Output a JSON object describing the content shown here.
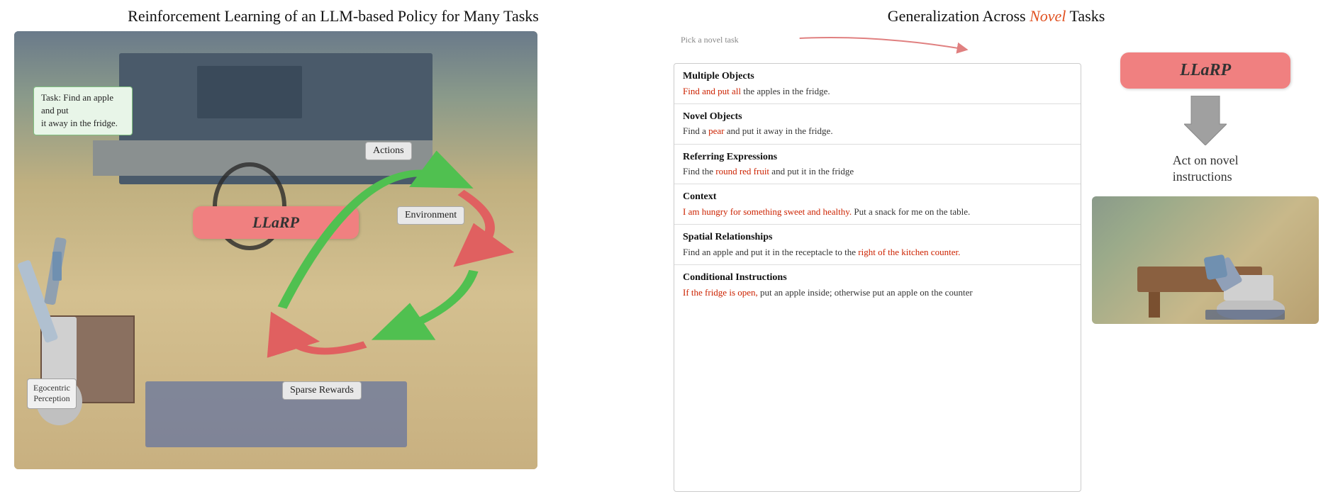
{
  "left": {
    "title": "Reinforcement Learning of an LLM-based Policy for Many Tasks",
    "task_label_line1": "Task: Find an apple and put",
    "task_label_line2": "it away in the fridge.",
    "llaarp_label": "LLaRP",
    "actions_label": "Actions",
    "environment_label": "Environment",
    "sparse_rewards_label": "Sparse Rewards",
    "egocentric_label_line1": "Egocentric",
    "egocentric_label_line2": "Perception"
  },
  "right": {
    "title_prefix": "Generalization Across ",
    "title_novel": "Novel",
    "title_suffix": " Tasks",
    "pick_novel_label": "Pick a novel task",
    "llaarp_label": "LLaRP",
    "act_on_label_line1": "Act on novel",
    "act_on_label_line2": "instructions",
    "tasks": [
      {
        "title": "Multiple Objects",
        "desc_before": "",
        "desc_highlight": "Find and put all",
        "desc_after": " the apples in the fridge."
      },
      {
        "title": "Novel Objects",
        "desc_before": "Find a ",
        "desc_highlight": "pear",
        "desc_after": " and put it away in the fridge."
      },
      {
        "title": "Referring Expressions",
        "desc_before": "Find the ",
        "desc_highlight": "round red fruit",
        "desc_after": " and put it in the fridge"
      },
      {
        "title": "Context",
        "desc_before": "",
        "desc_highlight": "I am hungry for something sweet and healthy.",
        "desc_after": " Put a snack for me on the table."
      },
      {
        "title": "Spatial Relationships",
        "desc_before": "Find an apple and put it in the receptacle to the ",
        "desc_highlight": "right of the kitchen counter.",
        "desc_after": ""
      },
      {
        "title": "Conditional Instructions",
        "desc_before": "",
        "desc_highlight": "If the fridge is open,",
        "desc_after": " put an apple inside; otherwise put an apple on the counter"
      }
    ]
  }
}
